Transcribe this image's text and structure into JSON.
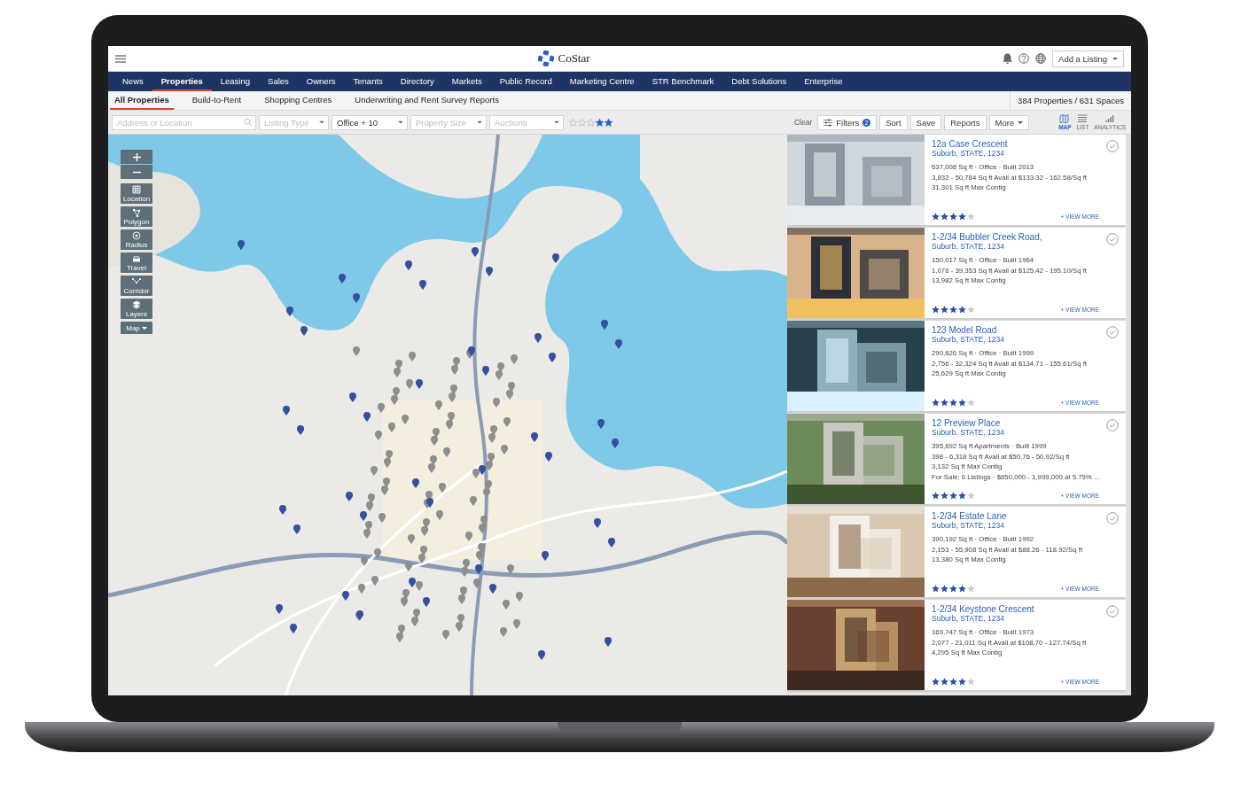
{
  "header": {
    "brand": "CoStar",
    "add_listing": "Add a Listing"
  },
  "nav": [
    {
      "label": "News",
      "selected": false
    },
    {
      "label": "Properties",
      "selected": true
    },
    {
      "label": "Leasing",
      "selected": false
    },
    {
      "label": "Sales",
      "selected": false
    },
    {
      "label": "Owners",
      "selected": false
    },
    {
      "label": "Tenants",
      "selected": false
    },
    {
      "label": "Directory",
      "selected": false
    },
    {
      "label": "Markets",
      "selected": false
    },
    {
      "label": "Public Record",
      "selected": false
    },
    {
      "label": "Marketing Centre",
      "selected": false
    },
    {
      "label": "STR Benchmark",
      "selected": false
    },
    {
      "label": "Debt Solutions",
      "selected": false
    },
    {
      "label": "Enterprise",
      "selected": false
    }
  ],
  "subnav": [
    {
      "label": "All Properties",
      "selected": true
    },
    {
      "label": "Build-to-Rent",
      "selected": false
    },
    {
      "label": "Shopping Centres",
      "selected": false
    },
    {
      "label": "Underwriting and Rent Survey Reports",
      "selected": false
    }
  ],
  "result_count": "384 Properties / 631 Spaces",
  "filters": {
    "address": {
      "placeholder": "Address or Location"
    },
    "listing_type": {
      "placeholder": "Listing Type"
    },
    "property_type": {
      "value": "Office + 10"
    },
    "property_size": {
      "placeholder": "Property Size"
    },
    "auctions": {
      "placeholder": "Auctions"
    },
    "star_rating": {
      "stars": 2
    }
  },
  "toolbar": {
    "clear": "Clear",
    "filters": "Filters",
    "filter_count": "2",
    "buttons": [
      "Sort",
      "Save",
      "Reports"
    ],
    "more": "More"
  },
  "views": [
    {
      "label": "MAP",
      "kind": "map",
      "selected": true
    },
    {
      "label": "LIST",
      "kind": "list",
      "selected": false
    },
    {
      "label": "ANALYTICS",
      "kind": "analytics",
      "selected": false
    }
  ],
  "map_tools": [
    {
      "label": "Location",
      "kind": "location"
    },
    {
      "label": "Polygon",
      "kind": "polygon"
    },
    {
      "label": "Radius",
      "kind": "radius"
    },
    {
      "label": "Travel",
      "kind": "travel"
    },
    {
      "label": "Corridor",
      "kind": "corridor"
    },
    {
      "label": "Layers",
      "kind": "layers"
    }
  ],
  "map_type": "Map",
  "listings": [
    {
      "title": "12a Case Crescent",
      "address": "Suburb, STATE, 1234",
      "lines": [
        "637,008 Sq ft · Office · Built 2013",
        "3,832 - 50,784 Sq ft Avail at $133.32 - 162.58/Sq ft",
        "31,301 Sq ft Max Contig"
      ],
      "stars": 4,
      "more": "+ VIEW MORE"
    },
    {
      "title": "1-2/34 Bubbler Creek Road,",
      "address": "Suburb, STATE, 1234",
      "lines": [
        "150,017 Sq ft · Office · Built 1964",
        "1,076 - 39,353 Sq ft Avail at $125.42 - 195.10/Sq ft",
        "13,982 Sq ft Max Contig"
      ],
      "stars": 4,
      "more": "+ VIEW MORE"
    },
    {
      "title": "123 Model Road",
      "address": "Suburb, STATE, 1234",
      "lines": [
        "290,626 Sq ft · Office · Built 1999",
        "2,756 - 32,324 Sq ft Avail at $134.71 - 155.61/Sq ft",
        "25,629 Sq ft Max Contig"
      ],
      "stars": 4,
      "more": "+ VIEW MORE"
    },
    {
      "title": "12 Preview Place",
      "address": "Suburb, STATE, 1234",
      "lines": [
        "395,692 Sq ft Apartments · Built 1999",
        "398 - 6,318 Sq ft Avail at $50.76 - 50.92/Sq ft",
        "3,132 Sq ft Max Contig",
        "For Sale: 6 Listings · $850,000 - 1,999,000 at 5.75% ..."
      ],
      "stars": 4,
      "more": "+ VIEW MORE"
    },
    {
      "title": "1-2/34 Estate Lane",
      "address": "Suburb, STATE, 1234",
      "lines": [
        "390,192 Sq ft · Office · Built 1992",
        "2,153 - 55,908 Sq ft Avail at $88.26 - 118.92/Sq ft",
        "13,380 Sq ft Max Contig"
      ],
      "stars": 4,
      "more": "+ VIEW MORE"
    },
    {
      "title": "1-2/34 Keystone Crescent",
      "address": "Suburb, STATE, 1234",
      "lines": [
        "169,747 Sq ft · Office · Built 1973",
        "2,077 - 21,011 Sq ft Avail at $108.70 - 127.74/Sq ft",
        "4,295 Sq ft Max Contig"
      ],
      "stars": 4,
      "more": "+ VIEW MORE"
    }
  ]
}
